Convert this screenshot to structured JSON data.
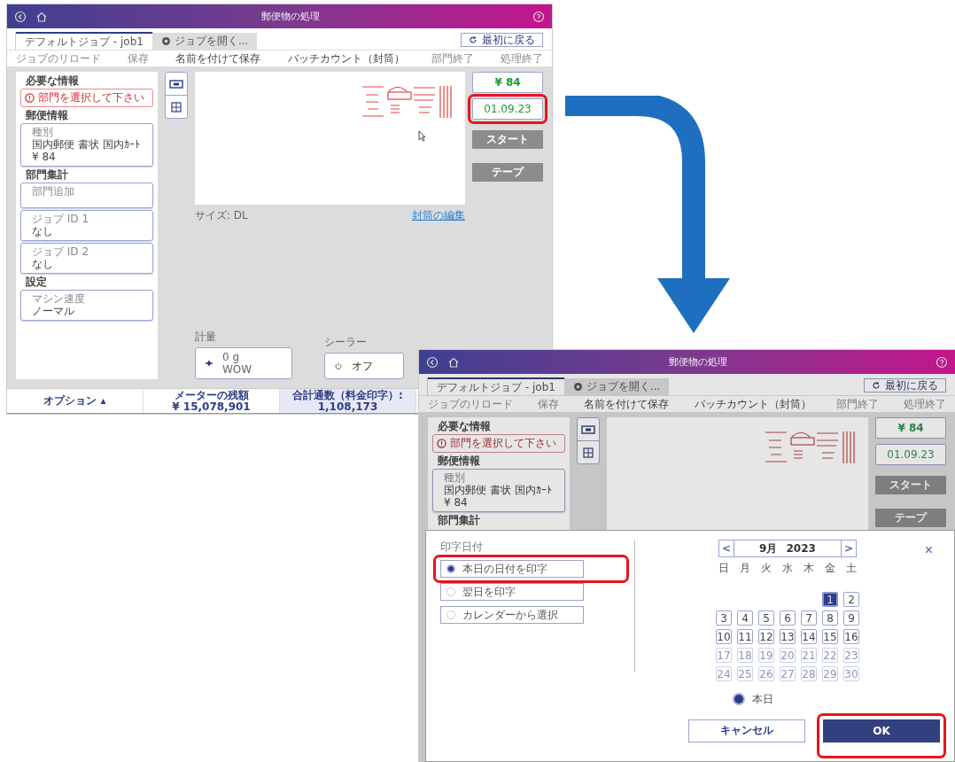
{
  "screens": [
    {
      "title": "郵便物の処理",
      "dimmed": false,
      "tabs": [
        {
          "label": "デフォルトジョブ - job1",
          "selected": true,
          "kind": "job"
        },
        {
          "label": "ジョブを開く...",
          "selected": false,
          "kind": "action"
        }
      ],
      "reset_button": "最初に戻る",
      "toolbar": [
        {
          "label": "ジョブのリロード",
          "disabled": true
        },
        {
          "label": "保存",
          "disabled": true
        },
        {
          "label": "名前を付けて保存",
          "disabled": false
        },
        {
          "label": "バッチカウント（封筒）",
          "disabled": false
        },
        {
          "label": "部門終了",
          "disabled": true
        },
        {
          "label": "処理終了",
          "disabled": true
        }
      ],
      "info_panel": [
        {
          "kind": "heading",
          "text": "必要な情報"
        },
        {
          "kind": "error",
          "text": "部門を選択して下さい"
        },
        {
          "kind": "heading",
          "text": "郵便情報"
        },
        {
          "kind": "card",
          "label": "種別",
          "lines": [
            "国内郵便 書状 国内ｶｰﾄ",
            "¥ 84"
          ]
        },
        {
          "kind": "heading",
          "text": "部門集計"
        },
        {
          "kind": "card",
          "label": "部門追加"
        },
        {
          "kind": "card",
          "label": "ジョブ ID 1",
          "lines": [
            "なし"
          ]
        },
        {
          "kind": "card",
          "label": "ジョブ ID 2",
          "lines": [
            "なし"
          ]
        },
        {
          "kind": "heading",
          "text": "設定"
        },
        {
          "kind": "card",
          "label": "マシン速度",
          "lines": [
            "ノーマル"
          ]
        }
      ],
      "price": "¥ 84",
      "date": {
        "text": "01.09.23",
        "highlighted": true
      },
      "action_buttons": [
        "スタート",
        "テープ"
      ],
      "size_label": "サイズ: DL",
      "edit_link": "封筒の編集",
      "weight": {
        "label": "計量",
        "lines": [
          "0 g",
          "WOW"
        ]
      },
      "sealer": {
        "label": "シーラー",
        "value": "オフ"
      },
      "footer": [
        {
          "lines": [
            "オプション ▴"
          ],
          "selected": false
        },
        {
          "lines": [
            "メーターの残額",
            "¥ 15,078,901"
          ],
          "selected": false
        },
        {
          "lines": [
            "合計通数（料金印字）:",
            "1,108,173"
          ],
          "selected": true
        }
      ]
    },
    {
      "title": "郵便物の処理",
      "dimmed": true,
      "tabs": [
        {
          "label": "デフォルトジョブ - job1",
          "selected": true,
          "kind": "job"
        },
        {
          "label": "ジョブを開く...",
          "selected": false,
          "kind": "action"
        }
      ],
      "reset_button": "最初に戻る",
      "toolbar": [
        {
          "label": "ジョブのリロード",
          "disabled": true
        },
        {
          "label": "保存",
          "disabled": true
        },
        {
          "label": "名前を付けて保存",
          "disabled": false
        },
        {
          "label": "バッチカウント（封筒）",
          "disabled": false
        },
        {
          "label": "部門終了",
          "disabled": true
        },
        {
          "label": "処理終了",
          "disabled": true
        }
      ],
      "info_panel": [
        {
          "kind": "heading",
          "text": "必要な情報"
        },
        {
          "kind": "error",
          "text": "部門を選択して下さい"
        },
        {
          "kind": "heading",
          "text": "郵便情報"
        },
        {
          "kind": "card",
          "label": "種別",
          "lines": [
            "国内郵便 書状 国内ｶｰﾄ",
            "¥ 84"
          ]
        },
        {
          "kind": "heading",
          "text": "部門集計"
        }
      ],
      "price": "¥ 84",
      "date": {
        "text": "01.09.23",
        "highlighted": false
      },
      "action_buttons": [
        "スタート",
        "テープ"
      ],
      "dialog": {
        "label": "印字日付",
        "options": [
          {
            "label": "本日の日付を印字",
            "selected": true,
            "highlighted": true
          },
          {
            "label": "翌日を印字",
            "selected": false,
            "highlighted": false
          },
          {
            "label": "カレンダーから選択",
            "selected": false,
            "highlighted": false
          }
        ],
        "calendar": {
          "prev": "<",
          "month": "9月",
          "year": "2023",
          "next": ">",
          "weekdays": [
            "日",
            "月",
            "火",
            "水",
            "木",
            "金",
            "土"
          ],
          "days": [
            {
              "kind": "blank"
            },
            {
              "kind": "blank"
            },
            {
              "kind": "blank"
            },
            {
              "kind": "blank"
            },
            {
              "kind": "blank"
            },
            {
              "kind": "day",
              "label": "1",
              "selected": true,
              "disabled": false
            },
            {
              "kind": "day",
              "label": "2",
              "selected": false,
              "disabled": false
            },
            {
              "kind": "day",
              "label": "3",
              "selected": false,
              "disabled": false
            },
            {
              "kind": "day",
              "label": "4",
              "selected": false,
              "disabled": false
            },
            {
              "kind": "day",
              "label": "5",
              "selected": false,
              "disabled": false
            },
            {
              "kind": "day",
              "label": "6",
              "selected": false,
              "disabled": false
            },
            {
              "kind": "day",
              "label": "7",
              "selected": false,
              "disabled": false
            },
            {
              "kind": "day",
              "label": "8",
              "selected": false,
              "disabled": false
            },
            {
              "kind": "day",
              "label": "9",
              "selected": false,
              "disabled": false
            },
            {
              "kind": "day",
              "label": "10",
              "selected": false,
              "disabled": false
            },
            {
              "kind": "day",
              "label": "11",
              "selected": false,
              "disabled": false
            },
            {
              "kind": "day",
              "label": "12",
              "selected": false,
              "disabled": false
            },
            {
              "kind": "day",
              "label": "13",
              "selected": false,
              "disabled": false
            },
            {
              "kind": "day",
              "label": "14",
              "selected": false,
              "disabled": false
            },
            {
              "kind": "day",
              "label": "15",
              "selected": false,
              "disabled": false
            },
            {
              "kind": "day",
              "label": "16",
              "selected": false,
              "disabled": false
            },
            {
              "kind": "day",
              "label": "17",
              "selected": false,
              "disabled": true
            },
            {
              "kind": "day",
              "label": "18",
              "selected": false,
              "disabled": true
            },
            {
              "kind": "day",
              "label": "19",
              "selected": false,
              "disabled": true
            },
            {
              "kind": "day",
              "label": "20",
              "selected": false,
              "disabled": true
            },
            {
              "kind": "day",
              "label": "21",
              "selected": false,
              "disabled": true
            },
            {
              "kind": "day",
              "label": "22",
              "selected": false,
              "disabled": true
            },
            {
              "kind": "day",
              "label": "23",
              "selected": false,
              "disabled": true
            },
            {
              "kind": "day",
              "label": "24",
              "selected": false,
              "disabled": true
            },
            {
              "kind": "day",
              "label": "25",
              "selected": false,
              "disabled": true
            },
            {
              "kind": "day",
              "label": "26",
              "selected": false,
              "disabled": true
            },
            {
              "kind": "day",
              "label": "27",
              "selected": false,
              "disabled": true
            },
            {
              "kind": "day",
              "label": "28",
              "selected": false,
              "disabled": true
            },
            {
              "kind": "day",
              "label": "29",
              "selected": false,
              "disabled": true
            },
            {
              "kind": "day",
              "label": "30",
              "selected": false,
              "disabled": true
            }
          ]
        },
        "today": {
          "label": "本日",
          "selected": true
        },
        "close": "×",
        "cancel": "キャンセル",
        "ok": {
          "label": "OK",
          "highlighted": true
        }
      }
    }
  ]
}
